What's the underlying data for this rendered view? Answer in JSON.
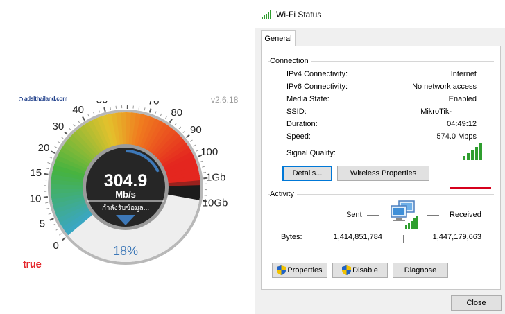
{
  "speedtest": {
    "logo_text": "adslthailand.com",
    "version": "v2.6.18",
    "brand": "true",
    "gauge": {
      "value": "304.9",
      "unit": "Mb/s",
      "status": "กำลังรับข้อมูล...",
      "percent_label": "18%",
      "progress_fraction": 0.18,
      "ticks": [
        "0",
        "5",
        "10",
        "15",
        "20",
        "30",
        "40",
        "50",
        "60",
        "70",
        "80",
        "90",
        "100",
        "1Gb",
        "10Gb"
      ],
      "colors": {
        "blue": "#3aa6c8",
        "green": "#46b33f",
        "yellow": "#e4c12c",
        "orange": "#f07a1f",
        "red": "#e4261f",
        "dark": "#1c1c1c",
        "accent": "#3d78b8"
      }
    }
  },
  "dialog": {
    "title": "Wi-Fi Status",
    "tab_general": "General",
    "connection": {
      "heading": "Connection",
      "rows": [
        {
          "label": "IPv4 Connectivity:",
          "value": "Internet"
        },
        {
          "label": "IPv6 Connectivity:",
          "value": "No network access"
        },
        {
          "label": "Media State:",
          "value": "Enabled"
        },
        {
          "label": "SSID:",
          "value": "MikroTik-"
        },
        {
          "label": "Duration:",
          "value": "04:49:12"
        },
        {
          "label": "Speed:",
          "value": "574.0 Mbps"
        }
      ],
      "signal_label": "Signal Quality:"
    },
    "buttons": {
      "details": "Details...",
      "wireless_properties": "Wireless Properties",
      "properties": "Properties",
      "disable": "Disable",
      "diagnose": "Diagnose",
      "close": "Close"
    },
    "activity": {
      "heading": "Activity",
      "sent_label": "Sent",
      "received_label": "Received",
      "bytes_label": "Bytes:",
      "bytes_sent": "1,414,851,784",
      "bytes_received": "1,447,179,663"
    },
    "accent_color": "#0078d7",
    "signal_color": "#2f9e2f"
  }
}
